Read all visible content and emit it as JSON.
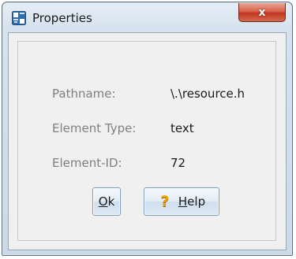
{
  "window": {
    "title": "Properties",
    "close_label": "x"
  },
  "fields": [
    {
      "label": "Pathname:",
      "value": "\\.\\resource.h"
    },
    {
      "label": "Element Type:",
      "value": "text"
    },
    {
      "label": "Element-ID:",
      "value": "72"
    }
  ],
  "buttons": {
    "ok_mnemonic": "O",
    "ok_rest": "k",
    "help_icon": "?",
    "help_mnemonic": "H",
    "help_rest": "elp"
  },
  "colors": {
    "label_text": "#808080",
    "close_button": "#c2371f",
    "help_icon": "#e8a000"
  },
  "icons": {
    "app": "properties-window-icon",
    "help": "question-mark-icon",
    "close": "close-icon"
  }
}
